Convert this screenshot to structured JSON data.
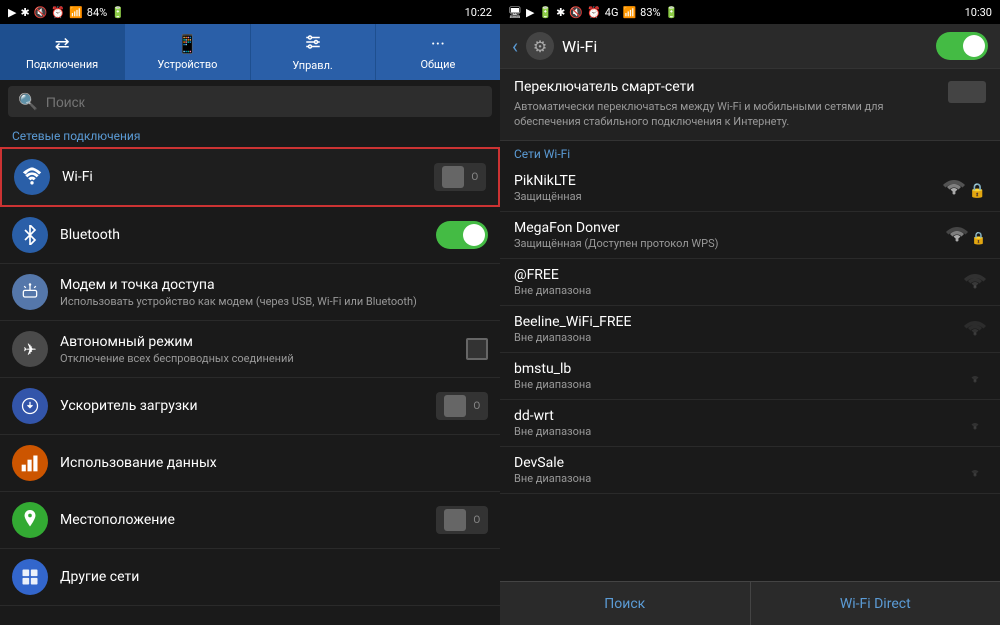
{
  "left": {
    "statusBar": {
      "left": "▶  ※ 🔇 ⏰ 📶 84% 🔋",
      "time": "10:22",
      "playIcon": "▶",
      "bluetoothIcon": "✱",
      "muteIcon": "🔇",
      "alarmIcon": "⏰",
      "signalIcon": "📶",
      "battery": "84%"
    },
    "tabs": [
      {
        "label": "Подключения",
        "icon": "⇄",
        "active": true
      },
      {
        "label": "Устройство",
        "icon": "📱",
        "active": false
      },
      {
        "label": "Управл.",
        "icon": "⚙",
        "active": false
      },
      {
        "label": "Общие",
        "icon": "···",
        "active": false
      }
    ],
    "searchPlaceholder": "Поиск",
    "sectionLabel": "Сетевые подключения",
    "items": [
      {
        "id": "wifi",
        "title": "Wi-Fi",
        "subtitle": "",
        "toggleState": "off",
        "highlighted": true
      },
      {
        "id": "bluetooth",
        "title": "Bluetooth",
        "subtitle": "",
        "toggleState": "on",
        "highlighted": false
      },
      {
        "id": "modem",
        "title": "Модем и точка доступа",
        "subtitle": "Использовать устройство как модем (через USB, Wi-Fi или Bluetooth)",
        "toggleState": "none",
        "highlighted": false
      },
      {
        "id": "airplane",
        "title": "Автономный режим",
        "subtitle": "Отключение всех беспроводных соединений",
        "toggleState": "checkbox",
        "highlighted": false
      },
      {
        "id": "download",
        "title": "Ускоритель загрузки",
        "subtitle": "",
        "toggleState": "off",
        "highlighted": false
      },
      {
        "id": "data",
        "title": "Использование данных",
        "subtitle": "",
        "toggleState": "none",
        "highlighted": false
      },
      {
        "id": "location",
        "title": "Местоположение",
        "subtitle": "",
        "toggleState": "off",
        "highlighted": false
      },
      {
        "id": "other",
        "title": "Другие сети",
        "subtitle": "",
        "toggleState": "none",
        "highlighted": false
      }
    ]
  },
  "right": {
    "statusBar": {
      "time": "10:30",
      "battery": "83%"
    },
    "header": {
      "backLabel": "‹",
      "settingsIcon": "⚙",
      "title": "Wi-Fi",
      "toggleOn": true
    },
    "smartSwitch": {
      "title": "Переключатель смарт-сети",
      "description": "Автоматически переключаться между Wi-Fi и мобильными сетями для обеспечения стабильного подключения к Интернету."
    },
    "networksLabel": "Сети Wi-Fi",
    "networks": [
      {
        "name": "PikNikLTE",
        "status": "Защищённая",
        "hasLock": true,
        "signalLevel": 4
      },
      {
        "name": "MegaFon Donver",
        "status": "Защищённая (Доступен протокол WPS)",
        "hasLock": true,
        "signalLevel": 3
      },
      {
        "name": "@FREE",
        "status": "Вне диапазона",
        "hasLock": false,
        "signalLevel": 1
      },
      {
        "name": "Beeline_WiFi_FREE",
        "status": "Вне диапазона",
        "hasLock": false,
        "signalLevel": 1
      },
      {
        "name": "bmstu_lb",
        "status": "Вне диапазона",
        "hasLock": false,
        "signalLevel": 1
      },
      {
        "name": "dd-wrt",
        "status": "Вне диапазона",
        "hasLock": false,
        "signalLevel": 1
      },
      {
        "name": "DevSale",
        "status": "Вне диапазона",
        "hasLock": false,
        "signalLevel": 1
      }
    ],
    "bottomButtons": [
      {
        "label": "Поиск"
      },
      {
        "label": "Wi-Fi Direct"
      }
    ]
  }
}
